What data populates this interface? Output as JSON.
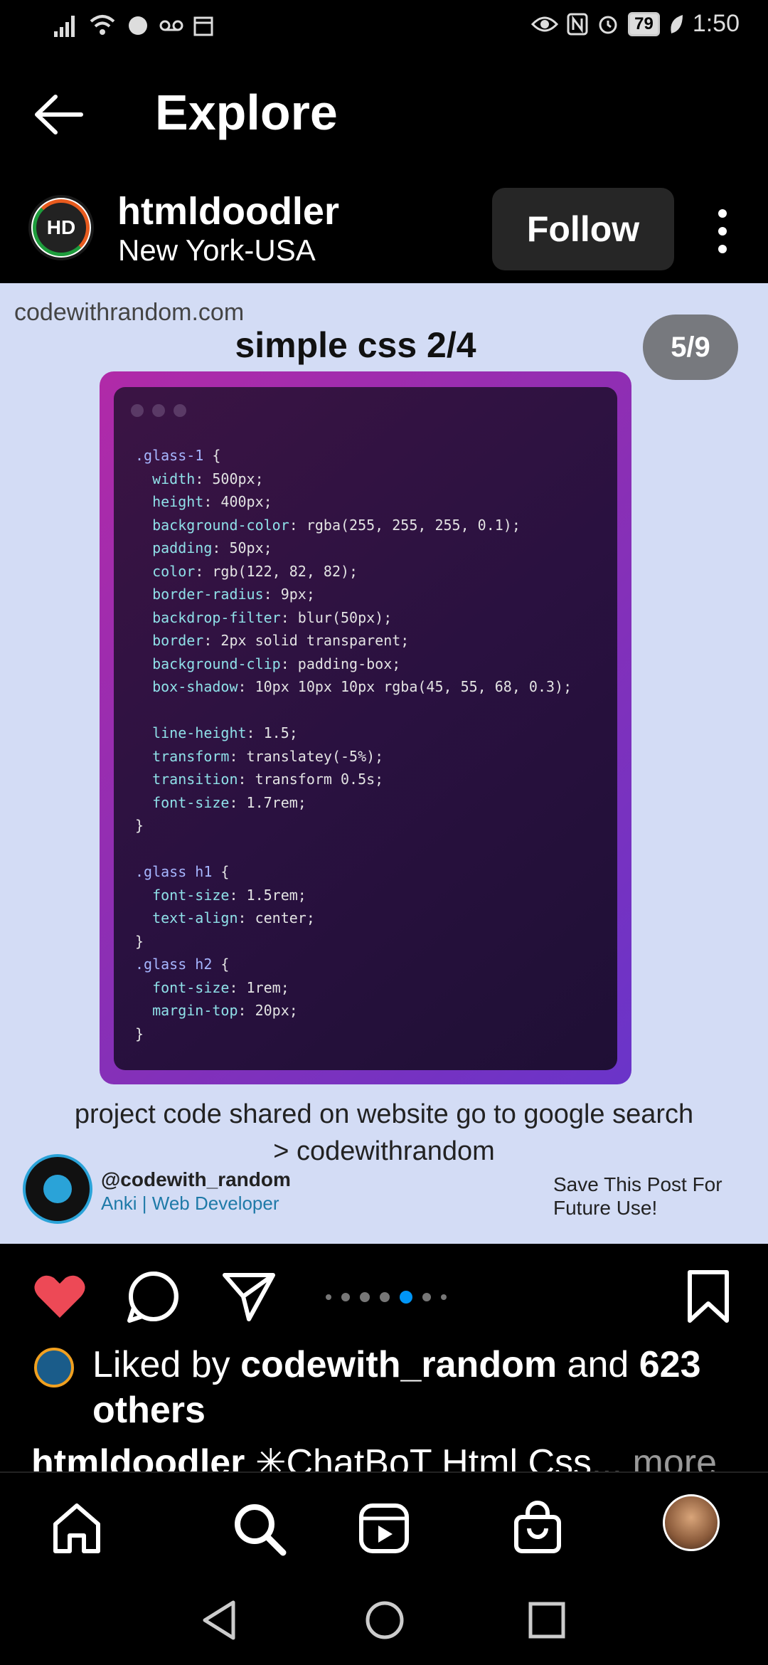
{
  "status_bar": {
    "battery": "79",
    "time": "1:50"
  },
  "header": {
    "title": "Explore"
  },
  "post": {
    "username": "htmldoodler",
    "location": "New York-USA",
    "follow_label": "Follow",
    "avatar_text": "HD"
  },
  "slide": {
    "site": "codewithrandom.com",
    "title": "simple css 2/4",
    "counter": "5/9",
    "code_lines": [
      ".glass-1 {",
      "  width: 500px;",
      "  height: 400px;",
      "  background-color: rgba(255, 255, 255, 0.1);",
      "  padding: 50px;",
      "  color: rgb(122, 82, 82);",
      "  border-radius: 9px;",
      "  backdrop-filter: blur(50px);",
      "  border: 2px solid transparent;",
      "  background-clip: padding-box;",
      "  box-shadow: 10px 10px 10px rgba(45, 55, 68, 0.3);",
      "",
      "  line-height: 1.5;",
      "  transform: translatey(-5%);",
      "  transition: transform 0.5s;",
      "  font-size: 1.7rem;",
      "}",
      "",
      ".glass h1 {",
      "  font-size: 1.5rem;",
      "  text-align: center;",
      "}",
      ".glass h2 {",
      "  font-size: 1rem;",
      "  margin-top: 20px;",
      "}"
    ],
    "caption_line1": "project code shared on website  go to  google search",
    "caption_line2": "> codewithrandom",
    "credit_handle": "@codewith_random",
    "credit_role": "Anki | Web Developer",
    "save_note_line1": "Save This Post For",
    "save_note_line2": "Future Use!"
  },
  "likes": {
    "prefix": "Liked by",
    "user": "codewith_random",
    "conjunction": "and",
    "count": "623",
    "suffix": "others"
  },
  "caption": {
    "user": "htmldoodler",
    "text": "✳ChatBoT Html Css",
    "more": "... more"
  },
  "colors": {
    "like_red": "#ed4956",
    "carousel_active": "#0095f6",
    "slide_bg": "#d3dcf5",
    "follow_bg": "#262626"
  }
}
